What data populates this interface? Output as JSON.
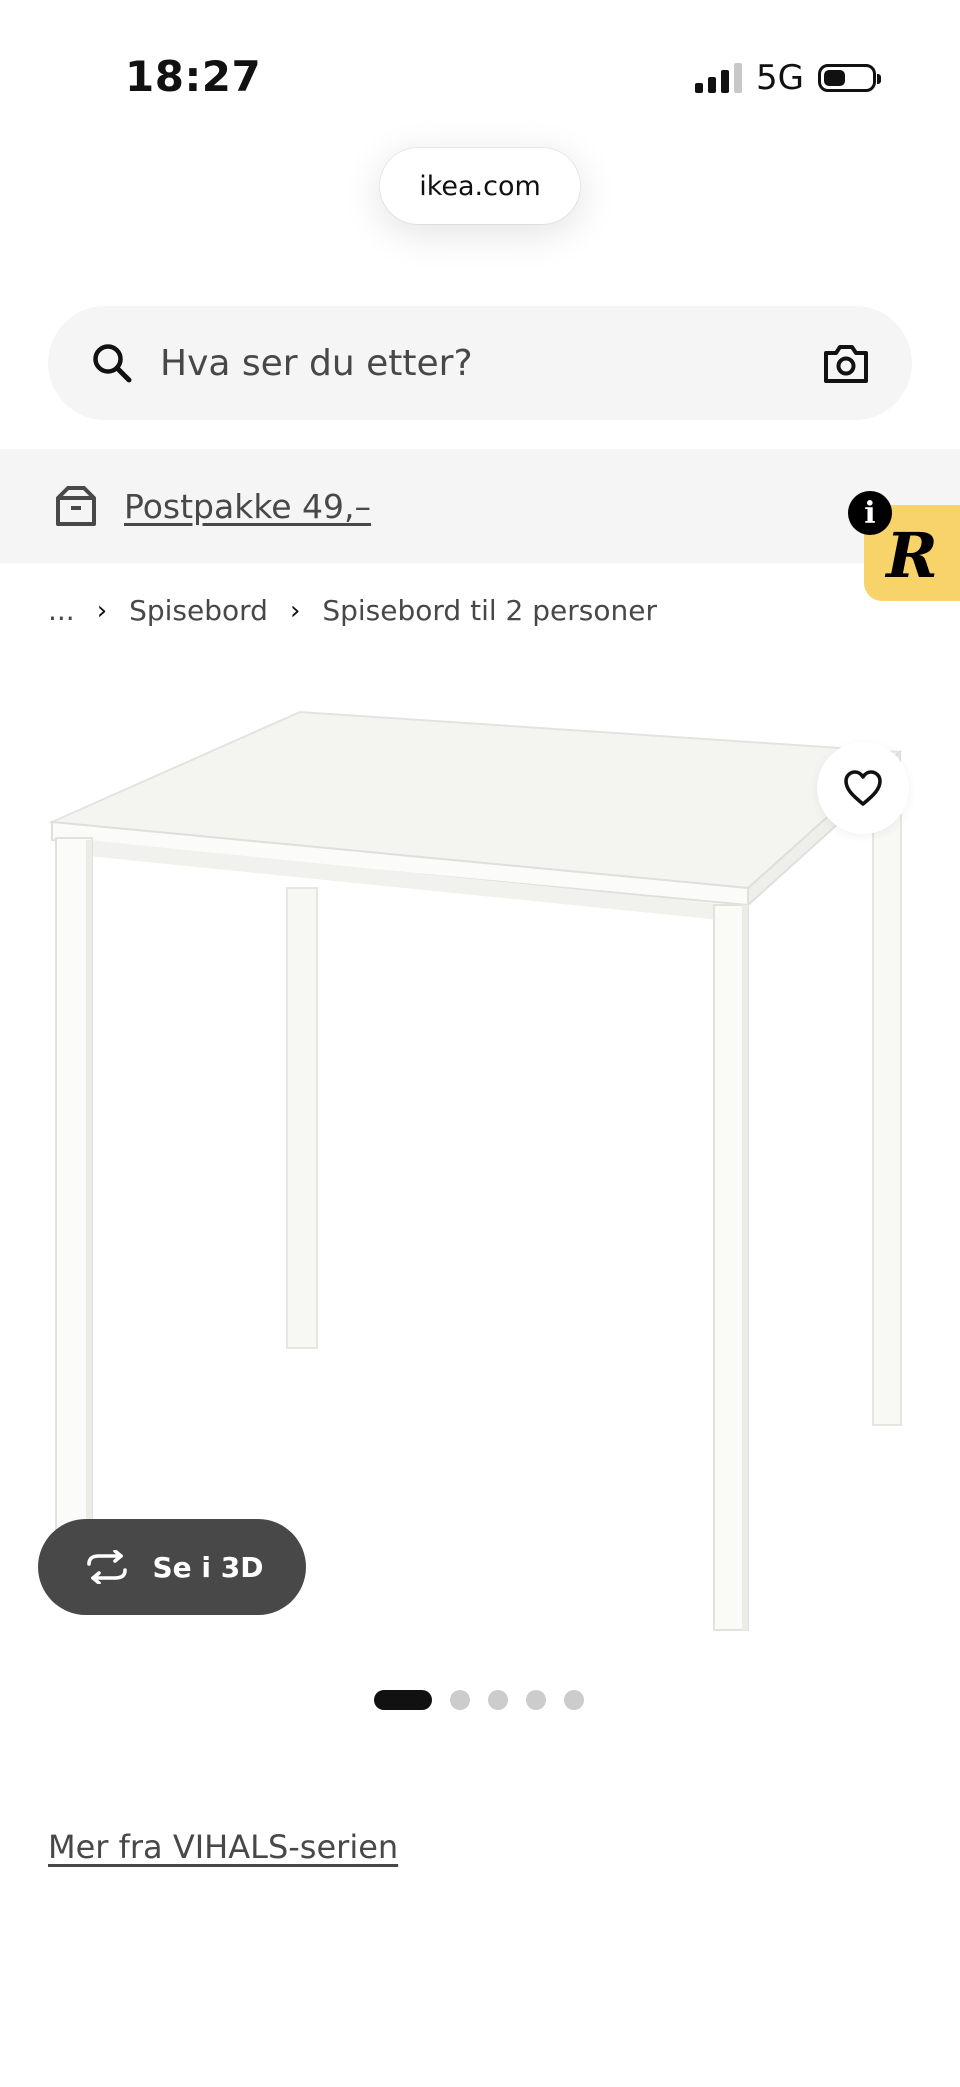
{
  "status_bar": {
    "time": "18:27",
    "network": "5G"
  },
  "browser": {
    "url": "ikea.com"
  },
  "search": {
    "placeholder": "Hva ser du etter?"
  },
  "banner": {
    "link_text": "Postpakke 49,–"
  },
  "widget": {
    "letter": "R",
    "info_symbol": "i"
  },
  "breadcrumb": {
    "items": [
      "...",
      "Spisebord",
      "Spisebord til 2 personer"
    ]
  },
  "product": {
    "view_3d_label": "Se i 3D",
    "image_count": 5,
    "active_image": 1
  },
  "series_link": "Mer fra VIHALS-serien",
  "colors": {
    "search_bg": "#f5f5f5",
    "banner_bg": "#f5f5f5",
    "widget_bg": "#f8d36a",
    "button_3d_bg": "#484848",
    "text_secondary": "#484848"
  },
  "icons": [
    "search-icon",
    "camera-icon",
    "box-icon",
    "heart-icon",
    "rotate-3d-icon",
    "chevron-right-icon"
  ]
}
